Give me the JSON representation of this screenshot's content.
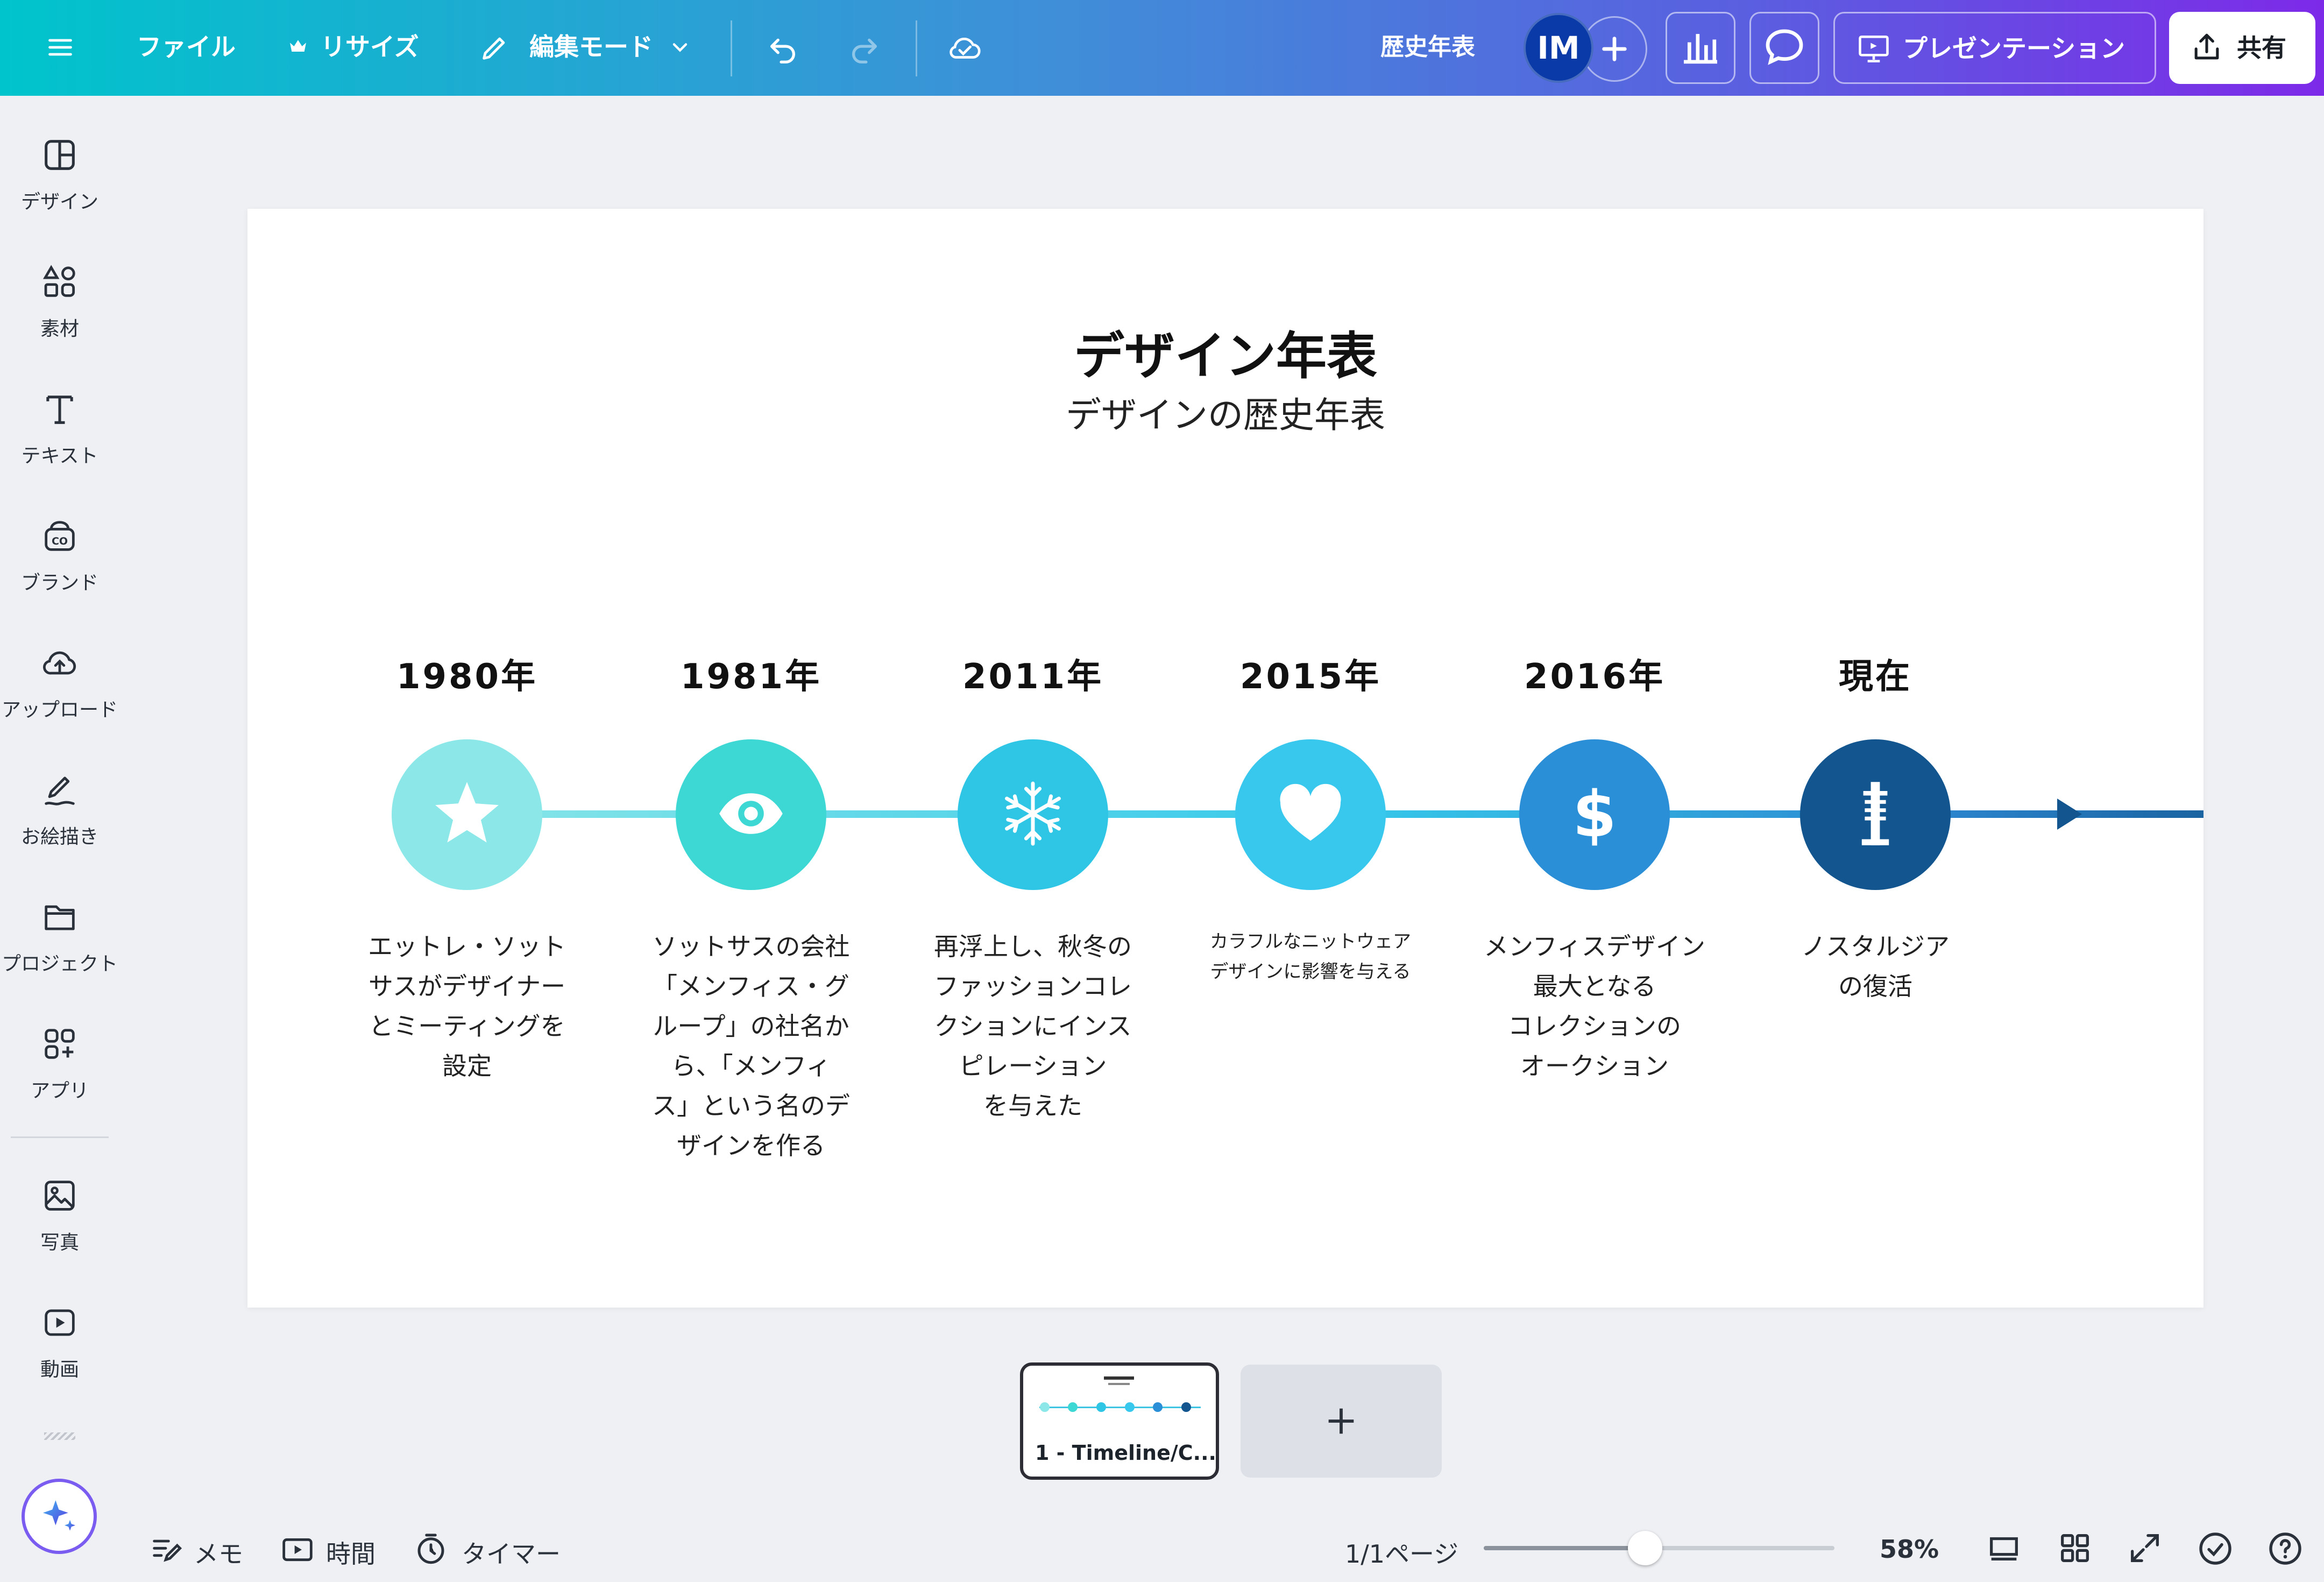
{
  "toolbar": {
    "file_label": "ファイル",
    "resize_label": "リサイズ",
    "edit_mode_label": "編集モード",
    "doc_title": "歴史年表",
    "avatar_initials": "IM",
    "present_label": "プレゼンテーション",
    "share_label": "共有"
  },
  "sidebar": {
    "items": [
      {
        "label": "デザイン",
        "icon": "design-icon"
      },
      {
        "label": "素材",
        "icon": "elements-icon"
      },
      {
        "label": "テキスト",
        "icon": "text-icon"
      },
      {
        "label": "ブランド",
        "icon": "brand-icon"
      },
      {
        "label": "アップロード",
        "icon": "upload-icon"
      },
      {
        "label": "お絵描き",
        "icon": "draw-icon"
      },
      {
        "label": "プロジェクト",
        "icon": "folder-icon"
      },
      {
        "label": "アプリ",
        "icon": "apps-icon"
      },
      {
        "label": "写真",
        "icon": "photo-icon"
      },
      {
        "label": "動画",
        "icon": "video-icon"
      }
    ]
  },
  "canvas": {
    "title": "デザイン年表",
    "subtitle": "デザインの歴史年表",
    "events": [
      {
        "year": "1980年",
        "icon": "star-icon",
        "color": "#8ce8e8",
        "lines": [
          "エットレ・ソット",
          "サスがデザイナー",
          "とミーティングを",
          "設定"
        ]
      },
      {
        "year": "1981年",
        "icon": "eye-icon",
        "color": "#3ed8d4",
        "lines": [
          "ソットサスの会社",
          "「メンフィス・グ",
          "ループ」の社名か",
          "ら、「メンフィ",
          "ス」という名のデ",
          "ザインを作る"
        ]
      },
      {
        "year": "2011年",
        "icon": "snowflake-icon",
        "color": "#2fc6e6",
        "lines": [
          "再浮上し、秋冬の",
          "ファッションコレ",
          "クションにインス",
          "ピレーション",
          "を与えた"
        ]
      },
      {
        "year": "2015年",
        "icon": "heart-icon",
        "color": "#38c8ee",
        "lines": [
          "カラフルなニットウェア",
          "デザインに影響を与える"
        ]
      },
      {
        "year": "2016年",
        "icon": "dollar-icon",
        "color": "#2a8fd6",
        "lines": [
          "メンフィスデザイン",
          "最大となる",
          "コレクションの",
          "オークション"
        ]
      },
      {
        "year": "現在",
        "icon": "tower-icon",
        "color": "#13558e",
        "lines": [
          "ノスタルジア",
          "の復活"
        ]
      }
    ]
  },
  "pages": {
    "thumb_label": "1 - Timeline/C...",
    "indicator": "1/1ページ"
  },
  "bottom": {
    "notes_label": "メモ",
    "duration_label": "時間",
    "timer_label": "タイマー",
    "zoom_label": "58%",
    "zoom_fraction": 0.46
  }
}
